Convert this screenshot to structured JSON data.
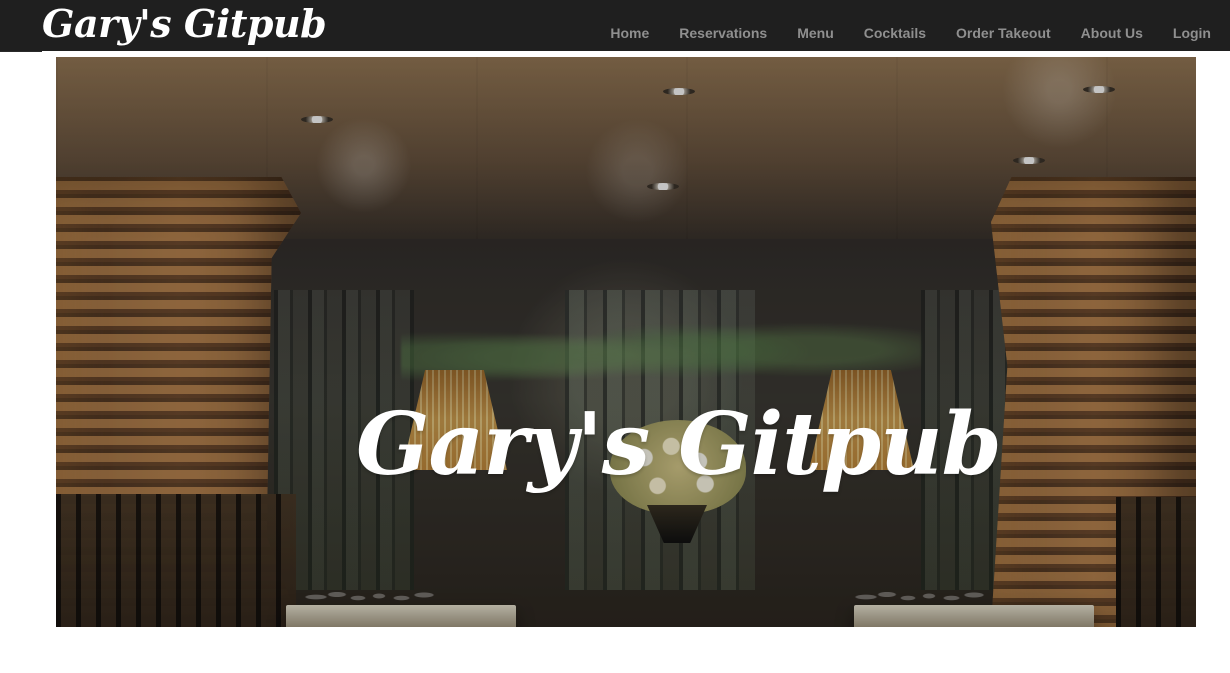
{
  "header": {
    "brand": "Gary's Gitpub",
    "nav": [
      {
        "label": "Home",
        "icon": ""
      },
      {
        "label": "Reservations",
        "icon": ""
      },
      {
        "label": "Menu",
        "icon": ""
      },
      {
        "label": "Cocktails",
        "icon": ""
      },
      {
        "label": "Order Takeout",
        "icon": ""
      },
      {
        "label": "About Us",
        "icon": ""
      },
      {
        "label": "Login",
        "icon": ""
      }
    ]
  },
  "hero": {
    "title": "Gary's Gitpub",
    "image": "restaurant-interior"
  },
  "colors": {
    "header_bg": "#1f1f1f",
    "nav_text": "#8f8f8f",
    "brand_text": "#ffffff",
    "hero_title": "#ffffff"
  }
}
